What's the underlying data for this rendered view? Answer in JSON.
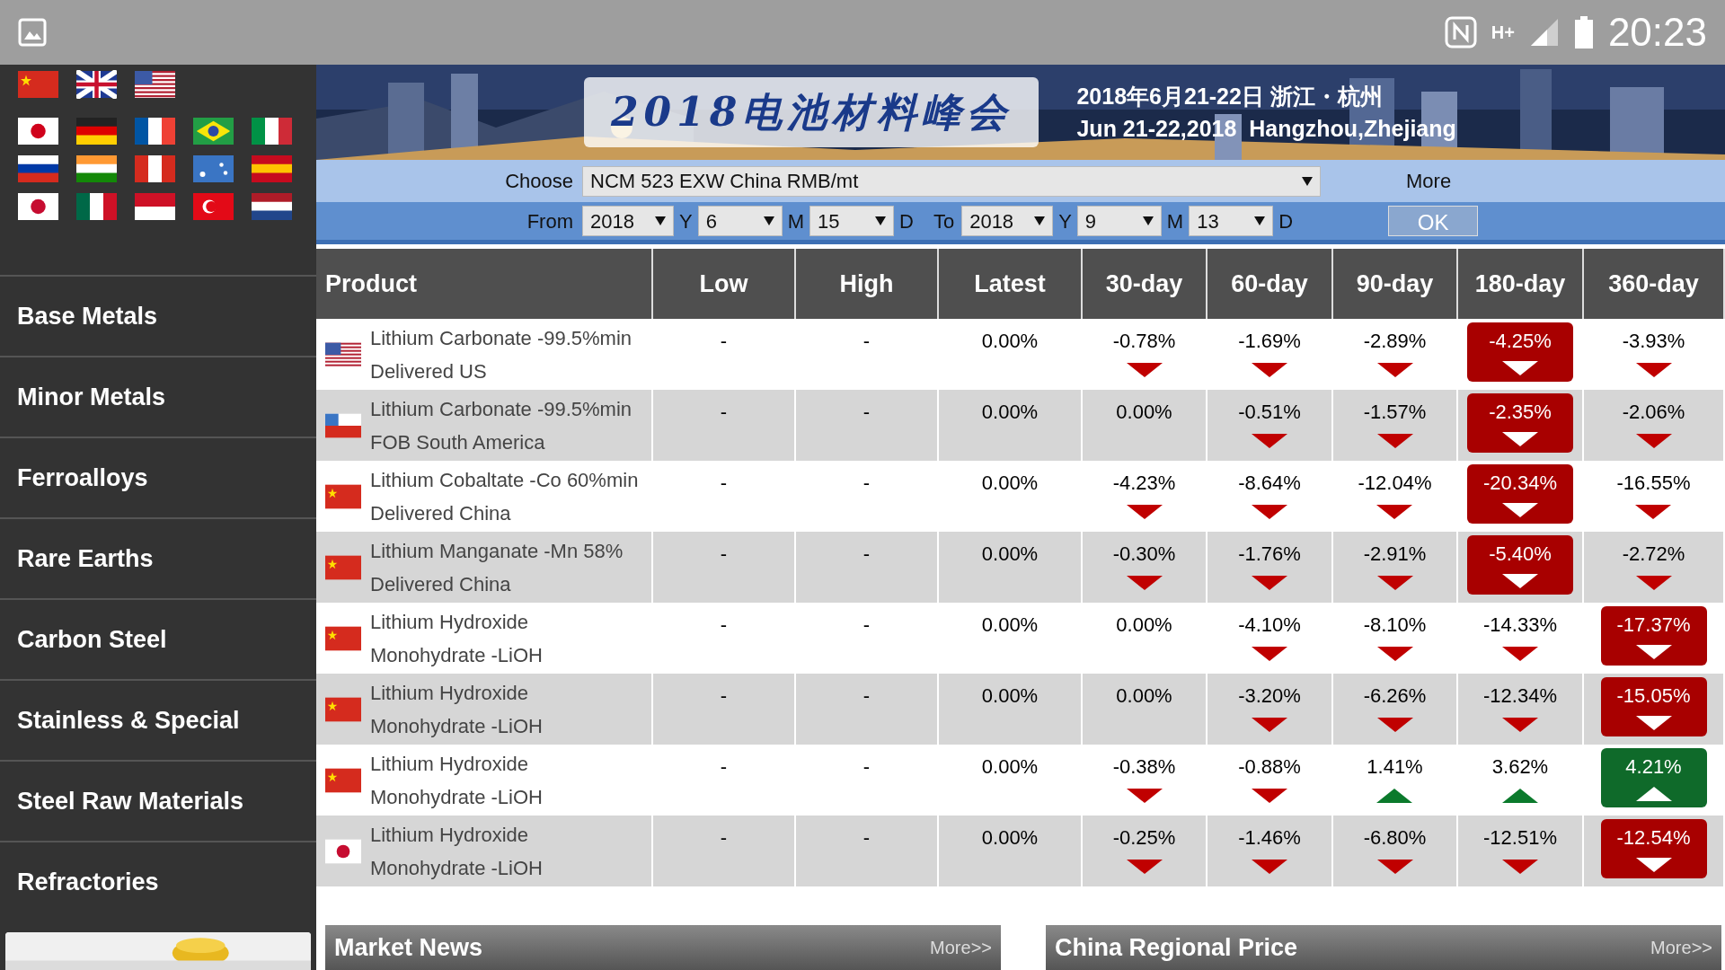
{
  "status_bar": {
    "time": "20:23",
    "network": "H+"
  },
  "banner": {
    "title": "2018电池材料峰会",
    "date_cn": "2018年6月21-22日 浙江・杭州",
    "date_en": "Jun 21-22,2018  Hangzhou,Zhejiang"
  },
  "sidebar": {
    "items": [
      {
        "label": "Base Metals"
      },
      {
        "label": "Minor Metals"
      },
      {
        "label": "Ferroalloys"
      },
      {
        "label": "Rare Earths"
      },
      {
        "label": "Carbon Steel"
      },
      {
        "label": "Stainless & Special"
      },
      {
        "label": "Steel Raw Materials"
      },
      {
        "label": "Refractories"
      }
    ]
  },
  "filter": {
    "choose_label": "Choose",
    "product": "NCM 523 EXW China RMB/mt",
    "more": "More",
    "from_label": "From",
    "to_label": "To",
    "from": [
      {
        "value": "2018",
        "unit": "Y"
      },
      {
        "value": "6",
        "unit": "M"
      },
      {
        "value": "15",
        "unit": "D"
      }
    ],
    "to": [
      {
        "value": "2018",
        "unit": "Y"
      },
      {
        "value": "9",
        "unit": "M"
      },
      {
        "value": "13",
        "unit": "D"
      }
    ],
    "ok": "OK"
  },
  "table": {
    "columns": [
      "Product",
      "Low",
      "High",
      "Latest",
      "30-day",
      "60-day",
      "90-day",
      "180-day",
      "360-day"
    ],
    "rows": [
      {
        "product": "Lithium Carbonate -99.5%min Delivered US",
        "low": "-",
        "high": "-",
        "latest": "0.00%",
        "changes": [
          {
            "value": "-0.78%",
            "kind": "down",
            "highlight": false
          },
          {
            "value": "-1.69%",
            "kind": "down",
            "highlight": false
          },
          {
            "value": "-2.89%",
            "kind": "down",
            "highlight": false
          },
          {
            "value": "-4.25%",
            "kind": "down",
            "highlight": true
          },
          {
            "value": "-3.93%",
            "kind": "down",
            "highlight": false
          }
        ]
      },
      {
        "product": "Lithium Carbonate -99.5%min FOB South America",
        "low": "-",
        "high": "-",
        "latest": "0.00%",
        "changes": [
          {
            "value": "0.00%",
            "kind": "flat",
            "highlight": false
          },
          {
            "value": "-0.51%",
            "kind": "down",
            "highlight": false
          },
          {
            "value": "-1.57%",
            "kind": "down",
            "highlight": false
          },
          {
            "value": "-2.35%",
            "kind": "down",
            "highlight": true
          },
          {
            "value": "-2.06%",
            "kind": "down",
            "highlight": false
          }
        ]
      },
      {
        "product": "Lithium Cobaltate -Co 60%min Delivered China",
        "low": "-",
        "high": "-",
        "latest": "0.00%",
        "changes": [
          {
            "value": "-4.23%",
            "kind": "down",
            "highlight": false
          },
          {
            "value": "-8.64%",
            "kind": "down",
            "highlight": false
          },
          {
            "value": "-12.04%",
            "kind": "down",
            "highlight": false
          },
          {
            "value": "-20.34%",
            "kind": "down",
            "highlight": true
          },
          {
            "value": "-16.55%",
            "kind": "down",
            "highlight": false
          }
        ]
      },
      {
        "product": "Lithium Manganate -Mn 58% Delivered China",
        "low": "-",
        "high": "-",
        "latest": "0.00%",
        "changes": [
          {
            "value": "-0.30%",
            "kind": "down",
            "highlight": false
          },
          {
            "value": "-1.76%",
            "kind": "down",
            "highlight": false
          },
          {
            "value": "-2.91%",
            "kind": "down",
            "highlight": false
          },
          {
            "value": "-5.40%",
            "kind": "down",
            "highlight": true
          },
          {
            "value": "-2.72%",
            "kind": "down",
            "highlight": false
          }
        ]
      },
      {
        "product": "Lithium Hydroxide Monohydrate -LiOH",
        "low": "-",
        "high": "-",
        "latest": "0.00%",
        "changes": [
          {
            "value": "0.00%",
            "kind": "flat",
            "highlight": false
          },
          {
            "value": "-4.10%",
            "kind": "down",
            "highlight": false
          },
          {
            "value": "-8.10%",
            "kind": "down",
            "highlight": false
          },
          {
            "value": "-14.33%",
            "kind": "down",
            "highlight": false
          },
          {
            "value": "-17.37%",
            "kind": "down",
            "highlight": true
          }
        ]
      },
      {
        "product": "Lithium Hydroxide Monohydrate -LiOH",
        "low": "-",
        "high": "-",
        "latest": "0.00%",
        "changes": [
          {
            "value": "0.00%",
            "kind": "flat",
            "highlight": false
          },
          {
            "value": "-3.20%",
            "kind": "down",
            "highlight": false
          },
          {
            "value": "-6.26%",
            "kind": "down",
            "highlight": false
          },
          {
            "value": "-12.34%",
            "kind": "down",
            "highlight": false
          },
          {
            "value": "-15.05%",
            "kind": "down",
            "highlight": true
          }
        ]
      },
      {
        "product": "Lithium Hydroxide Monohydrate -LiOH",
        "low": "-",
        "high": "-",
        "latest": "0.00%",
        "changes": [
          {
            "value": "-0.38%",
            "kind": "down",
            "highlight": false
          },
          {
            "value": "-0.88%",
            "kind": "down",
            "highlight": false
          },
          {
            "value": "1.41%",
            "kind": "up",
            "highlight": false
          },
          {
            "value": "3.62%",
            "kind": "up",
            "highlight": false
          },
          {
            "value": "4.21%",
            "kind": "up",
            "highlight": true
          }
        ]
      },
      {
        "product": "Lithium Hydroxide Monohydrate -LiOH",
        "low": "-",
        "high": "-",
        "latest": "0.00%",
        "changes": [
          {
            "value": "-0.25%",
            "kind": "down",
            "highlight": false
          },
          {
            "value": "-1.46%",
            "kind": "down",
            "highlight": false
          },
          {
            "value": "-6.80%",
            "kind": "down",
            "highlight": false
          },
          {
            "value": "-12.51%",
            "kind": "down",
            "highlight": false
          },
          {
            "value": "-12.54%",
            "kind": "down",
            "highlight": true
          }
        ]
      }
    ]
  },
  "panels": [
    {
      "title": "Market News",
      "more": "More>>"
    },
    {
      "title": "China Regional Price",
      "more": "More>>"
    }
  ]
}
